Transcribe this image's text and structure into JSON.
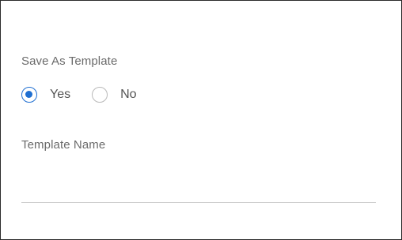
{
  "form": {
    "save_as_template": {
      "label": "Save As Template",
      "options": [
        {
          "label": "Yes",
          "selected": true
        },
        {
          "label": "No",
          "selected": false
        }
      ]
    },
    "template_name": {
      "label": "Template Name",
      "value": "",
      "placeholder": ""
    }
  },
  "colors": {
    "accent": "#1f6fd1",
    "label_text": "#6b6b6b",
    "underline": "#cfcfcf",
    "border": "#2b2b2b"
  }
}
